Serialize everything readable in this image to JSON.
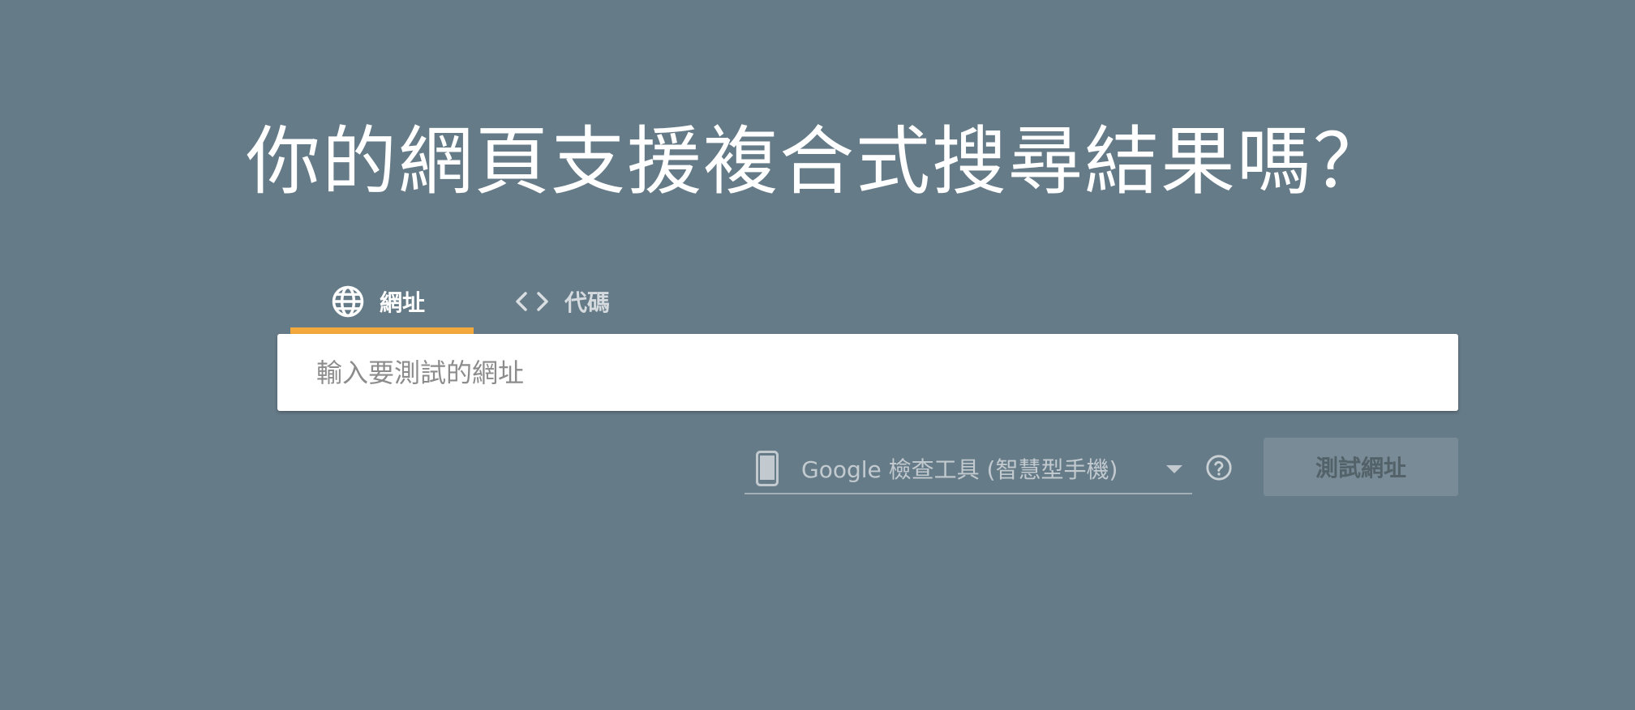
{
  "page": {
    "title": "你的網頁支援複合式搜尋結果嗎？"
  },
  "tabs": [
    {
      "label": "網址",
      "icon": "globe-icon",
      "active": true
    },
    {
      "label": "代碼",
      "icon": "code-icon",
      "active": false
    }
  ],
  "url_input": {
    "placeholder": "輸入要測試的網址",
    "value": ""
  },
  "agent_select": {
    "icon": "smartphone-icon",
    "selected": "Google 檢查工具 (智慧型手機)"
  },
  "help": {
    "icon": "help-icon"
  },
  "test_button": {
    "label": "測試網址",
    "enabled": false
  },
  "colors": {
    "background": "#667b88",
    "tab_indicator": "#f4a93d",
    "input_background": "#ffffff"
  }
}
